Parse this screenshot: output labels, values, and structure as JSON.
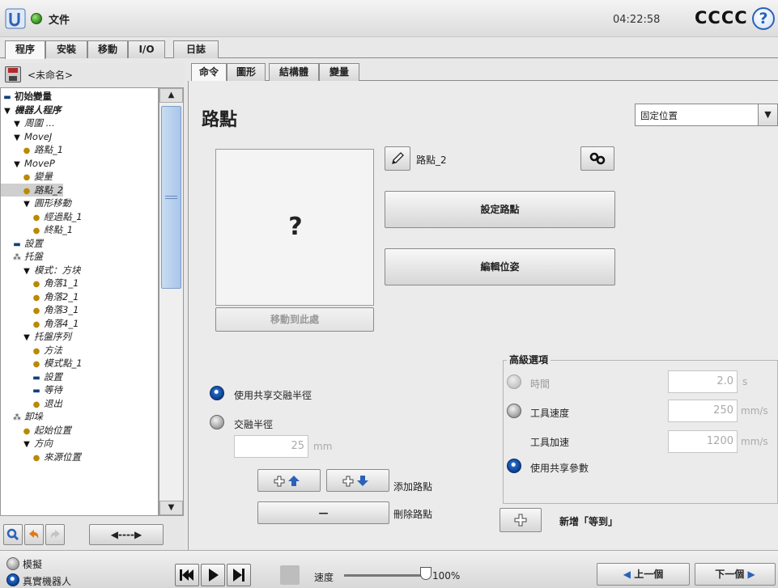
{
  "header": {
    "file_label": "文件",
    "clock": "04:22:58",
    "robot_name": "CCCC",
    "help_glyph": "?"
  },
  "main_tabs": [
    {
      "label": "程序",
      "active": true
    },
    {
      "label": "安裝",
      "active": false
    },
    {
      "label": "移動",
      "active": false
    },
    {
      "label": "I/O",
      "active": false
    },
    {
      "label": "日誌",
      "active": false
    }
  ],
  "program": {
    "name": "<未命名>",
    "tree": [
      {
        "label": "初始變量",
        "indent": 0,
        "icon": "bar",
        "italic": false,
        "bold": true
      },
      {
        "label": "機器人程序",
        "indent": 0,
        "icon": "tri",
        "italic": true,
        "bold": true
      },
      {
        "label": "周圍 ...",
        "indent": 1,
        "icon": "tri",
        "italic": true
      },
      {
        "label": "MoveJ",
        "indent": 1,
        "icon": "tri",
        "italic": true
      },
      {
        "label": "路點_1",
        "indent": 2,
        "icon": "dot",
        "italic": true
      },
      {
        "label": "MoveP",
        "indent": 1,
        "icon": "tri",
        "italic": true
      },
      {
        "label": "變量",
        "indent": 2,
        "icon": "dot",
        "italic": true
      },
      {
        "label": "路點_2",
        "indent": 2,
        "icon": "dot",
        "italic": true,
        "selected": true
      },
      {
        "label": "圓形移動",
        "indent": 2,
        "icon": "tri",
        "italic": true
      },
      {
        "label": "經過點_1",
        "indent": 3,
        "icon": "dot",
        "italic": true
      },
      {
        "label": "終點_1",
        "indent": 3,
        "icon": "dot",
        "italic": true
      },
      {
        "label": "設置",
        "indent": 1,
        "icon": "bar",
        "italic": true
      },
      {
        "label": "托盤",
        "indent": 1,
        "icon": "pal",
        "italic": true
      },
      {
        "label": "模式：方块",
        "indent": 2,
        "icon": "tri",
        "italic": true
      },
      {
        "label": "角落1_1",
        "indent": 3,
        "icon": "dot",
        "italic": true
      },
      {
        "label": "角落2_1",
        "indent": 3,
        "icon": "dot",
        "italic": true
      },
      {
        "label": "角落3_1",
        "indent": 3,
        "icon": "dot",
        "italic": true
      },
      {
        "label": "角落4_1",
        "indent": 3,
        "icon": "dot",
        "italic": true
      },
      {
        "label": "托盤序列",
        "indent": 2,
        "icon": "tri",
        "italic": true
      },
      {
        "label": "方法",
        "indent": 3,
        "icon": "dot",
        "italic": true
      },
      {
        "label": "模式點_1",
        "indent": 3,
        "icon": "dot",
        "italic": true
      },
      {
        "label": "設置",
        "indent": 3,
        "icon": "bar",
        "italic": true
      },
      {
        "label": "等待",
        "indent": 3,
        "icon": "bar",
        "italic": true
      },
      {
        "label": "退出",
        "indent": 3,
        "icon": "dot",
        "italic": true
      },
      {
        "label": "卸垛",
        "indent": 1,
        "icon": "pal",
        "italic": true
      },
      {
        "label": "起始位置",
        "indent": 2,
        "icon": "dot",
        "italic": true
      },
      {
        "label": "方向",
        "indent": 2,
        "icon": "tri",
        "italic": true
      },
      {
        "label": "來源位置",
        "indent": 3,
        "icon": "dot",
        "italic": true
      }
    ]
  },
  "tree_toolbar": {
    "search_icon": "search-icon",
    "undo_icon": "undo-icon",
    "redo_icon": "redo-icon",
    "move_icon": "move-arrows-icon",
    "move_glyph": "◀----▶"
  },
  "sub_tabs": [
    {
      "label": "命令",
      "active": true
    },
    {
      "label": "圖形",
      "active": false
    },
    {
      "label": "結構體",
      "active": false
    },
    {
      "label": "變量",
      "active": false
    }
  ],
  "waypoint": {
    "title": "路點",
    "position_type": "固定位置",
    "preview_glyph": "?",
    "move_here_label": "移動到此處",
    "name": "路點_2",
    "set_waypoint_label": "設定路點",
    "edit_pose_label": "編輯位姿",
    "blend": {
      "shared_label": "使用共享交融半徑",
      "radius_label": "交融半徑",
      "radius_value": "25",
      "radius_unit": "mm",
      "shared_selected": true
    },
    "add_waypoint_label": "添加路點",
    "delete_waypoint_label": "刪除路點",
    "delete_glyph": "—",
    "add_wait_label": "新增「等到」"
  },
  "advanced": {
    "title": "高級選項",
    "time_label": "時間",
    "time_value": "2.0",
    "time_unit": "s",
    "tool_speed_label": "工具速度",
    "tool_speed_value": "250",
    "tool_speed_unit": "mm/s",
    "tool_accel_label": "工具加速",
    "tool_accel_value": "1200",
    "tool_accel_unit": "mm/s",
    "shared_params_label": "使用共享參數",
    "shared_params_selected": true
  },
  "footer": {
    "simulation_label": "模擬",
    "real_robot_label": "真實機器人",
    "real_robot_selected": true,
    "speed_label": "速度",
    "speed_value": "100%",
    "speed_fraction": 1.0,
    "prev_label": "上一個",
    "next_label": "下一個"
  },
  "colors": {
    "accent_blue": "#1f67c9",
    "orange": "#e07a16",
    "green_status": "#2f8a1d"
  }
}
